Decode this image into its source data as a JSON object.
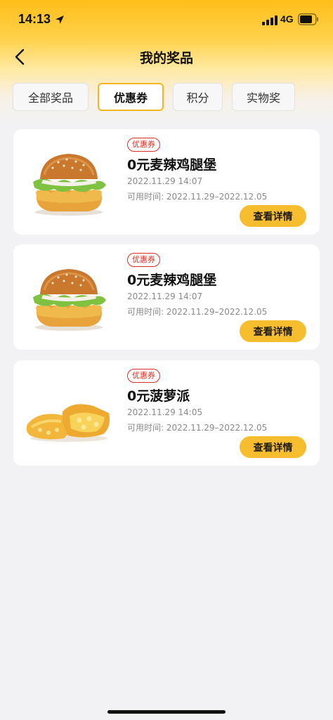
{
  "status_bar": {
    "time": "14:13",
    "network": "4G"
  },
  "header": {
    "title": "我的奖品"
  },
  "tabs": [
    {
      "label": "全部奖品",
      "active": false
    },
    {
      "label": "优惠券",
      "active": true
    },
    {
      "label": "积分",
      "active": false
    },
    {
      "label": "实物奖",
      "active": false
    }
  ],
  "items": [
    {
      "badge": "优惠券",
      "title": "0元麦辣鸡腿堡",
      "time": "2022.11.29 14:07",
      "validity": "可用时间: 2022.11.29–2022.12.05",
      "button": "查看详情",
      "image": "burger-image"
    },
    {
      "badge": "优惠券",
      "title": "0元麦辣鸡腿堡",
      "time": "2022.11.29 14:07",
      "validity": "可用时间: 2022.11.29–2022.12.05",
      "button": "查看详情",
      "image": "burger-image"
    },
    {
      "badge": "优惠券",
      "title": "0元菠萝派",
      "time": "2022.11.29 14:05",
      "validity": "可用时间: 2022.11.29–2022.12.05",
      "button": "查看详情",
      "image": "pineapple-pie-image"
    }
  ],
  "colors": {
    "accent": "#f6bd2e",
    "tab_active_border": "#f5b51c",
    "badge_red": "#d93025",
    "background": "#f2f2f4"
  }
}
